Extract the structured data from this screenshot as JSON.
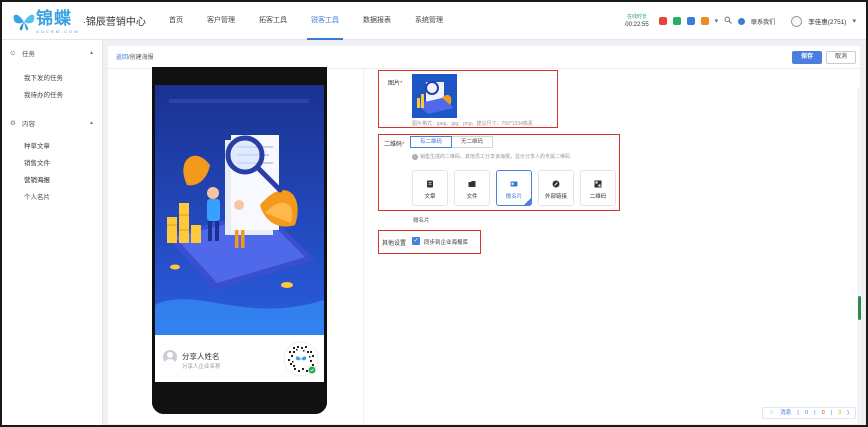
{
  "brand": {
    "name": "锦蝶",
    "domain": "GDCRM.COM",
    "title": "·锦辰营销中心"
  },
  "nav": {
    "items": [
      {
        "label": "首页",
        "active": false
      },
      {
        "label": "客户管理",
        "active": false
      },
      {
        "label": "拓客工具",
        "active": false
      },
      {
        "label": "锐客工具",
        "active": true
      },
      {
        "label": "数据报表",
        "active": false
      },
      {
        "label": "系统管理",
        "active": false
      }
    ]
  },
  "header": {
    "timer_label": "在线时长",
    "timer_value": "00:22:55",
    "contact_label": "联系我们",
    "user_name": "李佳惠(2751)",
    "app_icon_colors": [
      "#e5463b",
      "#27ae60",
      "#3d7bd9",
      "#f08a24"
    ]
  },
  "sidebar": {
    "groups": [
      {
        "label": "任务",
        "icon": "circle-icon",
        "items": [
          "我下发的任务",
          "我待办的任务"
        ]
      },
      {
        "label": "内容",
        "icon": "content-icon",
        "items": [
          "种草文章",
          "销售文件",
          "营销海报",
          "个人名片"
        ]
      }
    ],
    "active_item": "营销海报"
  },
  "breadcrumb": {
    "link": "返回",
    "current": "/创建海报"
  },
  "actions": {
    "save_label": "保存",
    "cancel_label": "取消"
  },
  "preview": {
    "share_name": "分享人姓名",
    "share_company": "分享人企业名称",
    "qr_brand": "锦蝶"
  },
  "form": {
    "image_label": "图片",
    "image_hint": "图片格式：jpeg、jpg、png，建议尺寸：750*1334像素",
    "qr_label": "二维码",
    "qr_tabs": [
      {
        "label": "有二维码",
        "active": true
      },
      {
        "label": "无二维码",
        "active": false
      }
    ],
    "qr_hint": "销售生成的二维码，其他员工分享该海报，显示分享人的专属二维码",
    "types": [
      {
        "label": "文章",
        "icon": "article-icon",
        "selected": false
      },
      {
        "label": "文件",
        "icon": "folder-icon",
        "selected": false
      },
      {
        "label": "微名片",
        "icon": "card-icon",
        "selected": true
      },
      {
        "label": "外部链接",
        "icon": "link-icon",
        "selected": false
      },
      {
        "label": "二维码",
        "icon": "qr-icon",
        "selected": false
      }
    ],
    "selected_type_label": "微名片",
    "other_label": "其他设置",
    "sync_label": "同步到企业海报库",
    "sync_checked": true
  },
  "message_bar": {
    "label": "消息",
    "count_blue": "0",
    "count_red": "0",
    "count_orange": "3"
  }
}
